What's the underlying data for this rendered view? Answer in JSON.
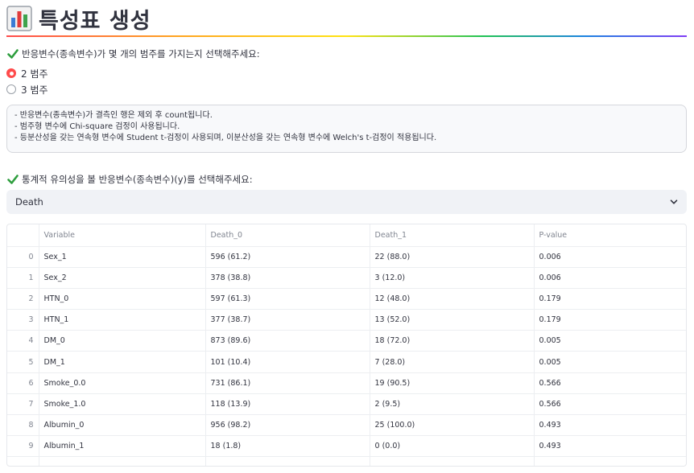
{
  "page": {
    "title": "특성표 생성"
  },
  "category_question": {
    "label": "반응변수(종속변수)가 몇 개의 범주를 가지는지 선택해주세요:",
    "options": [
      {
        "label": "2 범주",
        "selected": true
      },
      {
        "label": "3 범주",
        "selected": false
      }
    ]
  },
  "info": {
    "lines": [
      "- 반응변수(종속변수)가 결측인 행은 제외 후 count됩니다.",
      "- 범주형 변수에 Chi-square 검정이 사용됩니다.",
      "- 등분산성을 갖는 연속형 변수에 Student t-검정이 사용되며, 이분산성을 갖는 연속형 변수에 Welch's t-검정이 적용됩니다."
    ]
  },
  "response_select": {
    "label": "통계적 유의성을 볼 반응변수(종속변수)(y)를 선택해주세요:",
    "value": "Death"
  },
  "table": {
    "columns": [
      "",
      "Variable",
      "Death_0",
      "Death_1",
      "P-value"
    ],
    "rows": [
      [
        "0",
        "Sex_1",
        "596 (61.2)",
        "22 (88.0)",
        "0.006"
      ],
      [
        "1",
        "Sex_2",
        "378 (38.8)",
        "3 (12.0)",
        "0.006"
      ],
      [
        "2",
        "HTN_0",
        "597 (61.3)",
        "12 (48.0)",
        "0.179"
      ],
      [
        "3",
        "HTN_1",
        "377 (38.7)",
        "13 (52.0)",
        "0.179"
      ],
      [
        "4",
        "DM_0",
        "873 (89.6)",
        "18 (72.0)",
        "0.005"
      ],
      [
        "5",
        "DM_1",
        "101 (10.4)",
        "7 (28.0)",
        "0.005"
      ],
      [
        "6",
        "Smoke_0.0",
        "731 (86.1)",
        "19 (90.5)",
        "0.566"
      ],
      [
        "7",
        "Smoke_1.0",
        "118 (13.9)",
        "2 (9.5)",
        "0.566"
      ],
      [
        "8",
        "Albumin_0",
        "956 (98.2)",
        "25 (100.0)",
        "0.493"
      ],
      [
        "9",
        "Albumin_1",
        "18 (1.8)",
        "0 (0.0)",
        "0.493"
      ],
      [
        "",
        "",
        "",
        "",
        ""
      ]
    ]
  },
  "colors": {
    "accent": "#ff4b4b",
    "check": "#2e9e3e"
  },
  "icons": {
    "title": "bar-chart-icon",
    "check": "check-icon",
    "select": "chevron-down-icon"
  }
}
